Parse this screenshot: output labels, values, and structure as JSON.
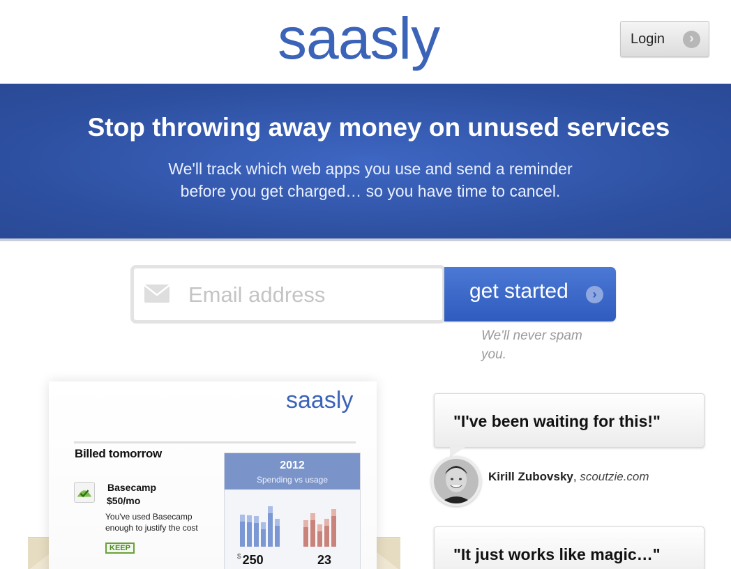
{
  "header": {
    "logo": "saasly",
    "login_label": "Login"
  },
  "hero": {
    "title": "Stop throwing away money on unused services",
    "subtitle_line1": "We'll track which web apps you use and send a reminder",
    "subtitle_line2": "before you get charged… so you have time to cancel."
  },
  "signup": {
    "email_placeholder": "Email address",
    "cta_label": "get started",
    "spam_note": "We'll never spam you."
  },
  "email_preview": {
    "logo": "saasly",
    "heading": "Billed tomorrow",
    "app_name": "Basecamp",
    "app_price": "$50/mo",
    "app_desc": "You've used Basecamp enough to justify the cost",
    "keep_label": "KEEP",
    "stats_year": "2012",
    "stats_label": "Spending vs usage",
    "spend_currency": "$",
    "spend_value": "250",
    "usage_value": "23",
    "spending_bars": [
      0.72,
      0.7,
      0.68,
      0.55,
      0.9,
      0.62
    ],
    "usage_bars": [
      0.6,
      0.75,
      0.5,
      0.62,
      0.85
    ]
  },
  "testimonials": [
    {
      "quote": "\"I've been waiting for this!\"",
      "name": "Kirill Zubovsky",
      "site": "scoutzie.com"
    },
    {
      "quote": "\"It just works like magic…\""
    }
  ],
  "colors": {
    "brand_blue": "#3b63b8",
    "hero_blue": "#2d4f9f",
    "keep_green": "#6aa13b"
  }
}
